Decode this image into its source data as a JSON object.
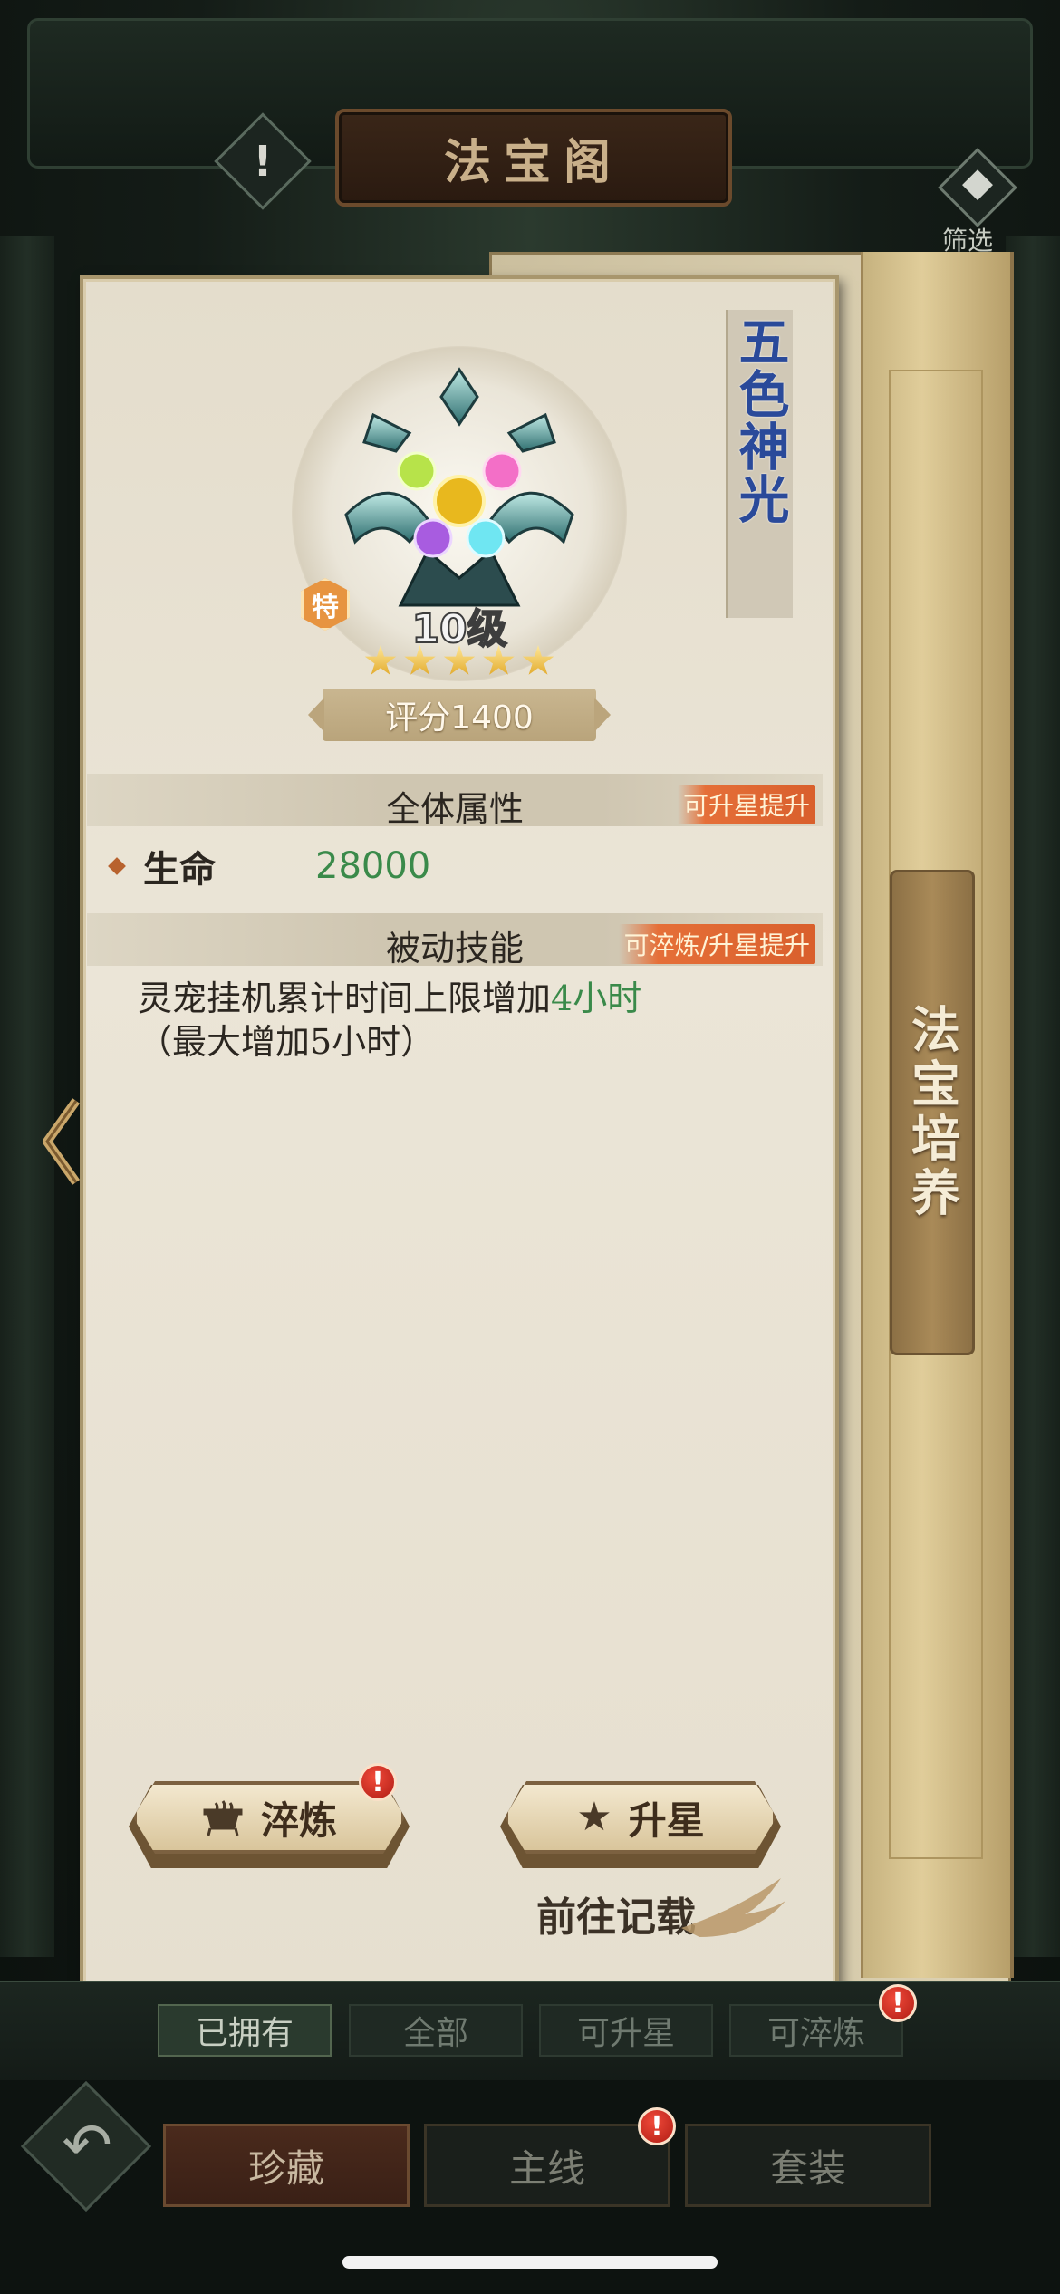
{
  "header": {
    "title": "法宝阁",
    "alert_icon": "!",
    "filter_label": "筛选"
  },
  "item": {
    "name": "五色神光",
    "level": "10级",
    "special_badge": "特",
    "stars": 5,
    "score": "评分1400"
  },
  "sections": {
    "attributes": {
      "title": "全体属性",
      "tag": "可升星提升"
    },
    "passive": {
      "title": "被动技能",
      "tag": "可淬炼/升星提升"
    }
  },
  "attributes": [
    {
      "label": "生命",
      "value": "28000"
    }
  ],
  "skill": {
    "text_prefix": "灵宠挂机累计时间上限增加",
    "text_highlight": "4小时",
    "text_suffix": "（最大增加5小时）"
  },
  "actions": {
    "refine_label": "淬炼",
    "upgrade_star_label": "升星",
    "goto_records": "前往记载",
    "notification_mark": "!"
  },
  "side_tab": {
    "label": "法宝培养"
  },
  "filter_tabs": [
    {
      "label": "已拥有",
      "active": true
    },
    {
      "label": "全部",
      "active": false
    },
    {
      "label": "可升星",
      "active": false
    },
    {
      "label": "可淬炼",
      "active": false
    }
  ],
  "bottom_nav": [
    {
      "label": "珍藏",
      "active": true
    },
    {
      "label": "主线",
      "active": false
    },
    {
      "label": "套装",
      "active": false
    }
  ],
  "colors": {
    "accent_green": "#3a8a4a",
    "tag_orange": "#e56f38",
    "name_blue": "#2a4a9a"
  }
}
